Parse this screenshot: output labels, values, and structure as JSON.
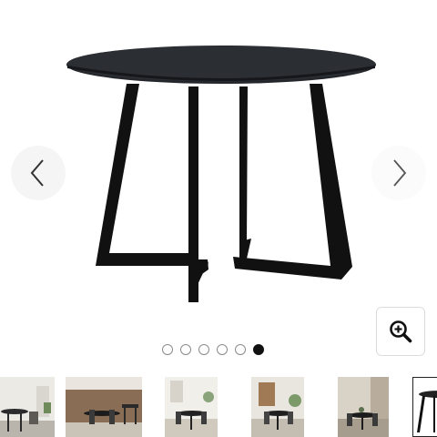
{
  "gallery": {
    "main_image": {
      "icon": "round-black-dining-table",
      "alt": ""
    },
    "prev_button": {
      "icon": "chevron-left-icon"
    },
    "next_button": {
      "icon": "chevron-right-icon"
    },
    "zoom_button": {
      "icon": "zoom-in-icon"
    },
    "dots": {
      "count": 6,
      "active_index": 5
    },
    "thumbnails": [
      {
        "scene": "dining-room-white-walls"
      },
      {
        "scene": "dining-room-brown-wall"
      },
      {
        "scene": "dining-room-bright"
      },
      {
        "scene": "dining-room-plants"
      },
      {
        "scene": "dining-room-beige"
      },
      {
        "scene": "table-product-shot",
        "selected": true
      }
    ]
  },
  "colors": {
    "table": "#111111",
    "accent": "#111111",
    "dot_border": "#8a8a8a"
  }
}
